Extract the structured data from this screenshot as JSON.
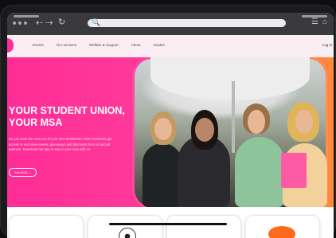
{
  "browser": {
    "search_icon": "search-icon",
    "back_icon": "arrow-left-icon",
    "forward_icon": "arrow-right-icon",
    "reload_icon": "reload-icon"
  },
  "site_nav": {
    "links": [
      "Events",
      "Our sections",
      "Welfare & Support",
      "About",
      "Guides"
    ],
    "login": "Log in"
  },
  "hero": {
    "headline_line1": "YOUR STUDENT UNION,",
    "headline_line2": "YOUR MSA",
    "blurb": "Do you want the most out of your time at Münster? MSA members get access to exclusive events, giveaways and discounts from us and all partners. Download our app to stay in your loop with us.",
    "cta": "Join MSA →"
  },
  "colors": {
    "brand_pink": "#ff2c96",
    "accent_orange": "#ff8a3a"
  }
}
